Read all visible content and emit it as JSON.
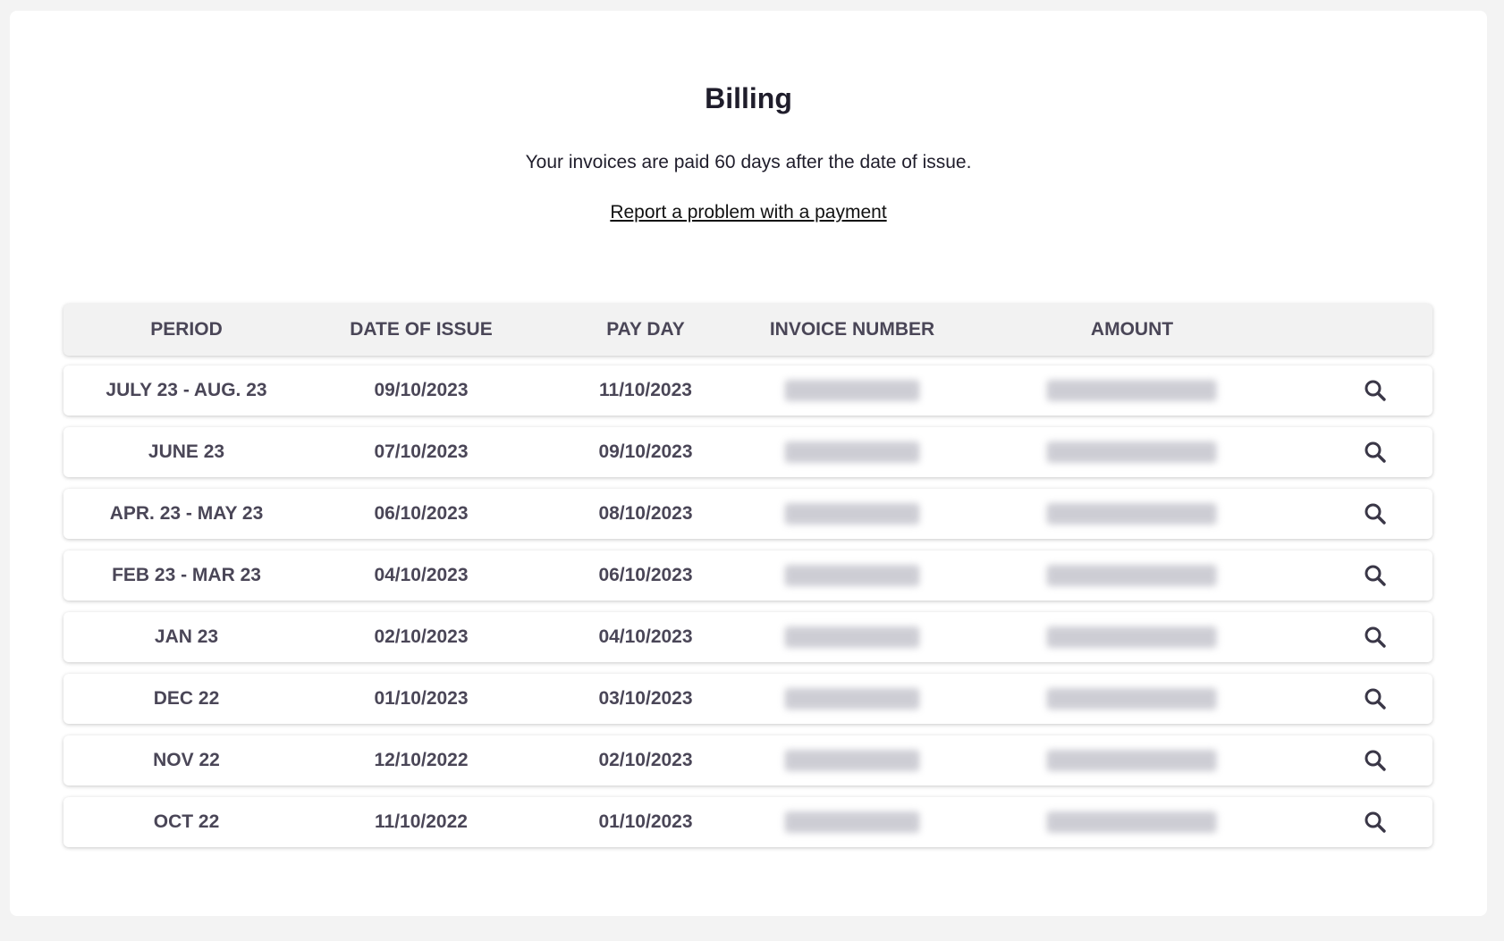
{
  "page": {
    "title": "Billing",
    "subtitle": "Your invoices are paid 60 days after the date of issue.",
    "report_link": "Report a problem with a payment"
  },
  "table": {
    "columns": [
      "PERIOD",
      "DATE OF ISSUE",
      "PAY DAY",
      "INVOICE NUMBER",
      "AMOUNT",
      ""
    ],
    "rows": [
      {
        "period": "JULY 23 - AUG. 23",
        "issue": "09/10/2023",
        "pay": "11/10/2023"
      },
      {
        "period": "JUNE 23",
        "issue": "07/10/2023",
        "pay": "09/10/2023"
      },
      {
        "period": "APR. 23 - MAY 23",
        "issue": "06/10/2023",
        "pay": "08/10/2023"
      },
      {
        "period": "FEB 23 - MAR 23",
        "issue": "04/10/2023",
        "pay": "06/10/2023"
      },
      {
        "period": "JAN 23",
        "issue": "02/10/2023",
        "pay": "04/10/2023"
      },
      {
        "period": "DEC 22",
        "issue": "01/10/2023",
        "pay": "03/10/2023"
      },
      {
        "period": "NOV 22",
        "issue": "12/10/2022",
        "pay": "02/10/2023"
      },
      {
        "period": "OCT 22",
        "issue": "11/10/2022",
        "pay": "01/10/2023"
      }
    ],
    "row_action_icon": "search-icon"
  },
  "colors": {
    "background": "#f3f3f3",
    "card": "#ffffff",
    "text_dark": "#1f1d2b",
    "table_text": "#4a4657",
    "header_bg": "#f2f2f2"
  }
}
